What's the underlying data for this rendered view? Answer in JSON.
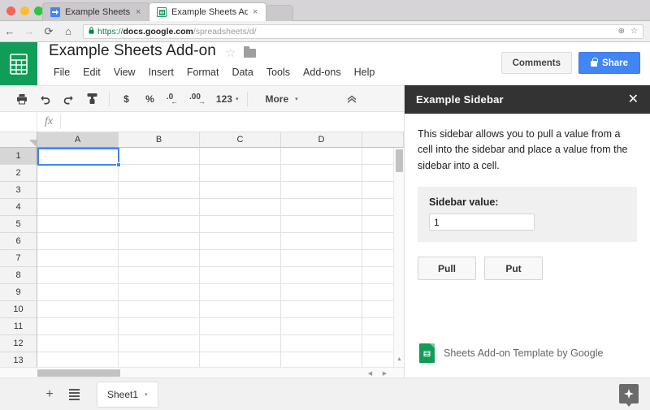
{
  "browser": {
    "tabs": [
      {
        "title": "Example Sheets Add-on",
        "favicon": "apps-script-icon",
        "active": false
      },
      {
        "title": "Example Sheets Add-on - Goo",
        "favicon": "sheets-icon",
        "active": true
      }
    ],
    "nav": {
      "back": "←",
      "forward": "→",
      "reload": "⟳",
      "home": "⌂"
    },
    "url": {
      "lock": "🔒",
      "scheme": "https://",
      "host": "docs.google.com",
      "path": "/spreadsheets/d/",
      "zoom_icon": "⊕",
      "bookmark_icon": "☆"
    },
    "close_label": "×"
  },
  "sheets": {
    "logo_name": "sheets-logo",
    "doc_title": "Example Sheets Add-on",
    "star_icon": "☆",
    "folder_icon": "folder-icon",
    "menus": [
      "File",
      "Edit",
      "View",
      "Insert",
      "Format",
      "Data",
      "Tools",
      "Add-ons",
      "Help"
    ],
    "comments_label": "Comments",
    "share_label": "Share",
    "accent_green": "#0f9d58",
    "accent_blue": "#4285f4"
  },
  "toolbar": {
    "items": [
      {
        "name": "print-icon",
        "glyph": "⎙"
      },
      {
        "name": "undo-icon",
        "glyph": "↶"
      },
      {
        "name": "redo-icon",
        "glyph": "↷"
      },
      {
        "name": "paint-format-icon",
        "glyph": "⎇"
      }
    ],
    "currency_label": "$",
    "percent_label": "%",
    "decrease_decimal_label": ".0",
    "increase_decimal_label": ".00",
    "number_format_label": "123",
    "more_label": "More",
    "caret": "▾",
    "collapse_icon": "«"
  },
  "formula_bar": {
    "fx_label": "fx",
    "value": "",
    "name_box": ""
  },
  "grid": {
    "columns": [
      "A",
      "B",
      "C",
      "D"
    ],
    "rows": [
      "1",
      "2",
      "3",
      "4",
      "5",
      "6",
      "7",
      "8",
      "9",
      "10",
      "11",
      "12",
      "13"
    ],
    "selected_cell": "A1",
    "scroll_up_arrow": "▲",
    "scroll_down_arrow": "▼",
    "scroll_left_arrow": "◀",
    "scroll_right_arrow": "▶"
  },
  "sheet_bar": {
    "add_sheet_label": "+",
    "all_sheets_label": "all-sheets-icon",
    "sheet_name": "Sheet1",
    "sheet_caret": "▾",
    "explore_label": "✦"
  },
  "sidebar": {
    "title": "Example Sidebar",
    "close_label": "✕",
    "description": "This sidebar allows you to pull a value from a cell into the sidebar and place a value from the sidebar into a cell.",
    "value_label": "Sidebar value:",
    "value": "1",
    "pull_label": "Pull",
    "put_label": "Put",
    "footer_text": "Sheets Add-on Template by Google",
    "footer_icon": "sheets-icon",
    "header_bg": "#333333"
  }
}
